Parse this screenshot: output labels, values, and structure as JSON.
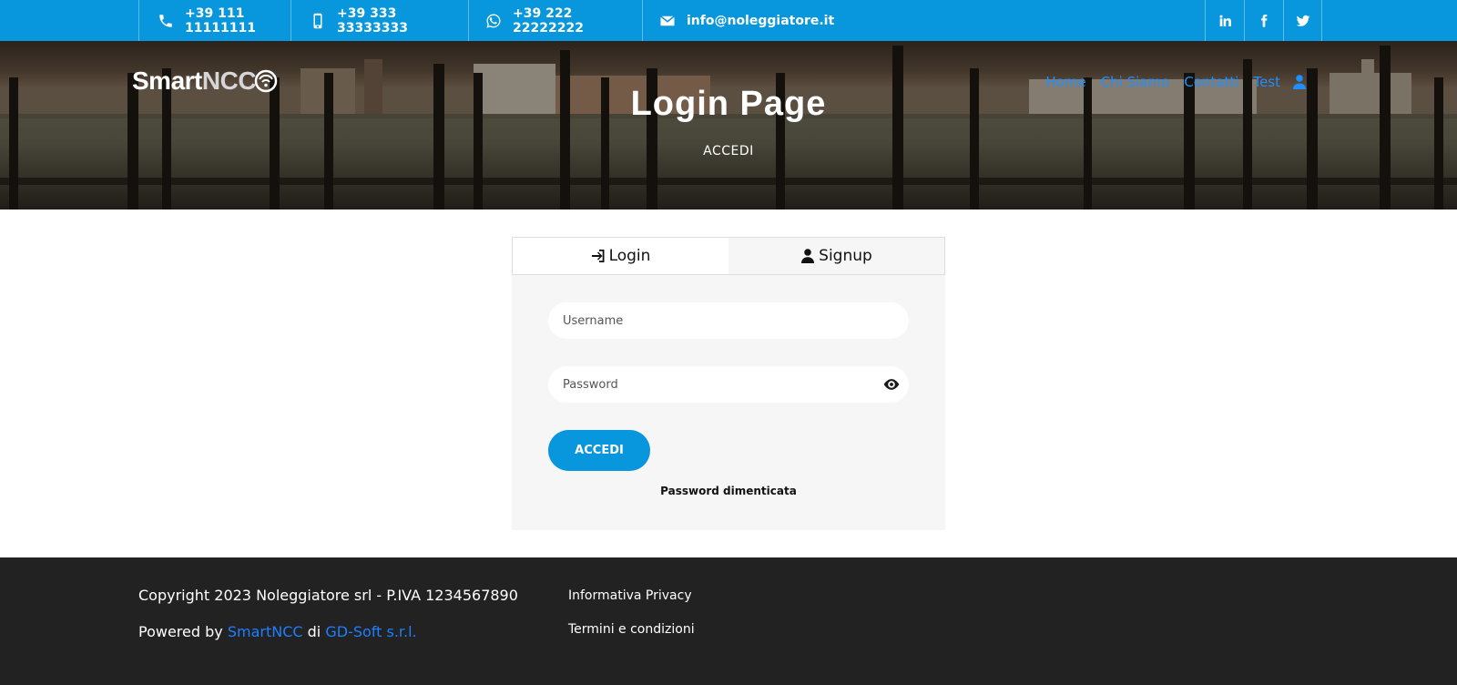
{
  "topbar": {
    "phone": "+39 111 11111111",
    "mobile": "+39 333 33333333",
    "whatsapp": "+39 222 22222222",
    "email": "info@noleggiatore.it",
    "icons": [
      "phone-icon",
      "mobile-icon",
      "whatsapp-icon",
      "envelope-icon",
      "linkedin-icon",
      "facebook-icon",
      "twitter-icon"
    ]
  },
  "hero": {
    "logo_smart": "Smart",
    "logo_ncc": "NCC",
    "title": "Login Page",
    "subtitle": "ACCEDI"
  },
  "nav": {
    "items": [
      "Home",
      "Chi Siamo",
      "Contatti",
      "Test"
    ]
  },
  "login": {
    "tabs": [
      "Login",
      "Signup"
    ],
    "username_placeholder": "Username",
    "password_placeholder": "Password",
    "submit_label": "ACCEDI",
    "forgot_label": "Password dimenticata"
  },
  "footer": {
    "copyright": "Copyright 2023 Noleggiatore srl - P.IVA 1234567890",
    "powered_prefix": "Powered by",
    "powered_link1": "SmartNCC",
    "powered_mid": "di",
    "powered_link2": "GD-Soft s.r.l.",
    "privacy": "Informativa Privacy",
    "terms": "Termini e condizioni"
  },
  "colors": {
    "accent": "#0896dc",
    "link": "#1e90ff",
    "footer_bg": "#222222",
    "card_bg": "#f6f6f6"
  }
}
